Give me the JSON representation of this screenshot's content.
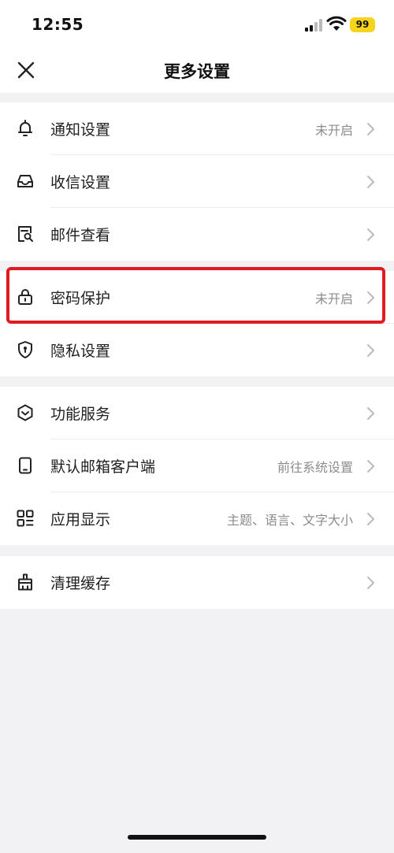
{
  "status_bar": {
    "time": "12:55",
    "battery": "99"
  },
  "navbar": {
    "title": "更多设置",
    "close_icon": "close-icon"
  },
  "groups": [
    {
      "items": [
        {
          "label": "通知设置",
          "value": "未开启",
          "icon": "bell-icon"
        },
        {
          "label": "收信设置",
          "value": "",
          "icon": "inbox-icon"
        },
        {
          "label": "邮件查看",
          "value": "",
          "icon": "mail-view-icon"
        }
      ]
    },
    {
      "items": [
        {
          "label": "密码保护",
          "value": "未开启",
          "icon": "lock-icon"
        },
        {
          "label": "隐私设置",
          "value": "",
          "icon": "shield-icon"
        }
      ]
    },
    {
      "items": [
        {
          "label": "功能服务",
          "value": "",
          "icon": "service-icon"
        },
        {
          "label": "默认邮箱客户端",
          "value": "前往系统设置",
          "icon": "phone-icon"
        },
        {
          "label": "应用显示",
          "value": "主题、语言、文字大小",
          "icon": "grid-icon"
        }
      ]
    },
    {
      "items": [
        {
          "label": "清理缓存",
          "value": "",
          "icon": "broom-icon"
        }
      ]
    }
  ],
  "colors": {
    "highlight": "#e21a22",
    "battery": "#f6d31d",
    "background": "#f2f2f4"
  }
}
